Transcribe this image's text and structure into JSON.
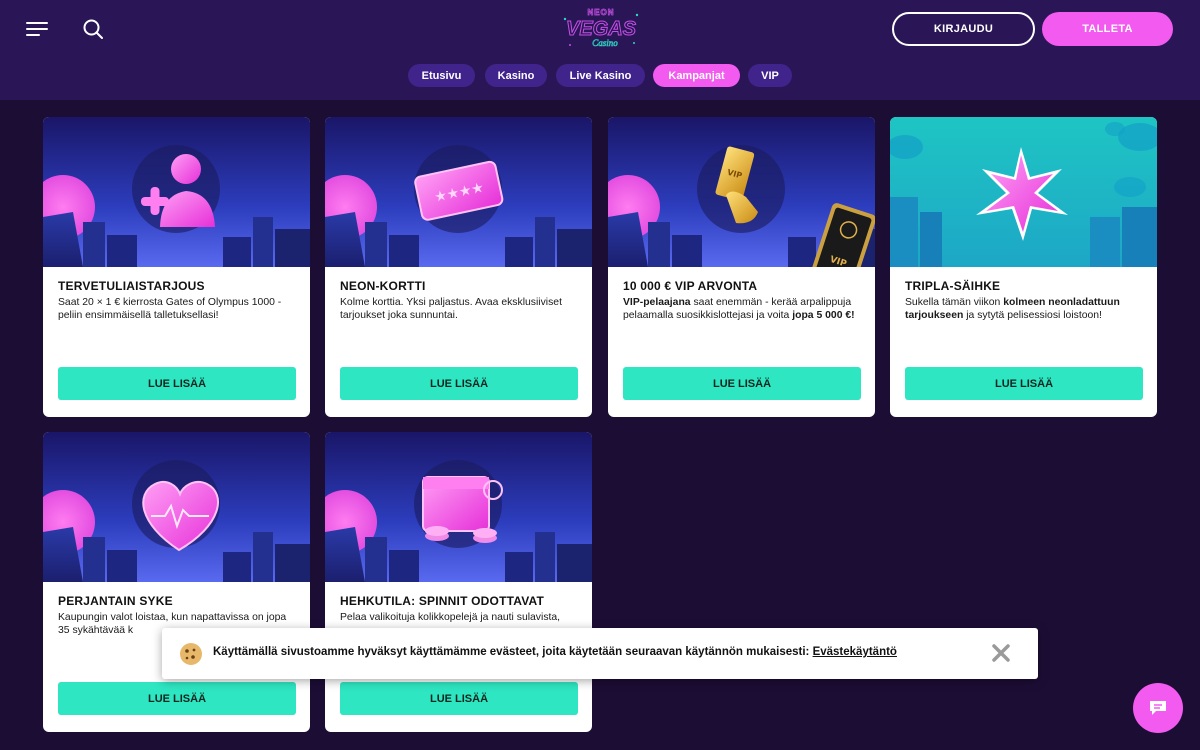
{
  "header": {
    "logo_text_top": "NEON",
    "logo_text_main": "VEGAS",
    "logo_text_sub": "Casino",
    "login_label": "KIRJAUDU",
    "deposit_label": "TALLETA"
  },
  "nav": [
    {
      "label": "Etusivu",
      "active": false
    },
    {
      "label": "Kasino",
      "active": false
    },
    {
      "label": "Live Kasino",
      "active": false
    },
    {
      "label": "Kampanjat",
      "active": true
    },
    {
      "label": "VIP",
      "active": false
    }
  ],
  "cards": [
    {
      "title": "TERVETULIAISTARJOUS",
      "desc_parts": [
        {
          "t": "Saat 20 × 1 € kierrosta Gates of Olympus 1000 -peliin ensimmäisellä talletuksellasi!",
          "b": false
        }
      ],
      "button": "LUE LISÄÄ",
      "icon": "add-user-icon"
    },
    {
      "title": "NEON-KORTTI",
      "desc_parts": [
        {
          "t": "Kolme korttia. Yksi paljastus. Avaa eksklusiiviset tarjoukset joka sunnuntai.",
          "b": false
        }
      ],
      "button": "LUE LISÄÄ",
      "icon": "ticket-icon"
    },
    {
      "title": "10 000 € VIP ARVONTA",
      "desc_parts": [
        {
          "t": "VIP-pelaajana",
          "b": true
        },
        {
          "t": " saat enemmän - kerää arpalippuja pelaamalla suosikkislottejasi ja voita ",
          "b": false
        },
        {
          "t": "jopa 5 000 €!",
          "b": true
        }
      ],
      "button": "LUE LISÄÄ",
      "icon": "vip-ticket-icon"
    },
    {
      "title": "TRIPLA-SÄIHKE",
      "desc_parts": [
        {
          "t": "Sukella tämän viikon ",
          "b": false
        },
        {
          "t": "kolmeen neonladattuun tarjoukseen",
          "b": true
        },
        {
          "t": " ja sytytä pelisessiosi loistoon!",
          "b": false
        }
      ],
      "button": "LUE LISÄÄ",
      "icon": "sparkle-icon"
    },
    {
      "title": "PERJANTAIN SYKE",
      "desc_parts": [
        {
          "t": "Kaupungin valot loistaa, kun napattavissa on jopa 35 sykähtävää k",
          "b": false
        }
      ],
      "button": "LUE LISÄÄ",
      "icon": "heart-icon"
    },
    {
      "title": "HEHKUTILA: SPINNIT ODOTTAVAT",
      "desc_parts": [
        {
          "t": "Pelaa valikoituja kolikkopelejä ja nauti sulavista,",
          "b": false
        }
      ],
      "button": "LUE LISÄÄ",
      "icon": "calendar-coins-icon"
    }
  ],
  "cookie": {
    "text": "Käyttämällä sivustoamme hyväksyt käyttämämme evästeet, joita käytetään seuraavan käytännön mukaisesti: ",
    "link": "Evästekäytäntö"
  },
  "colors": {
    "header_bg": "#2a1656",
    "page_bg": "#1c0d35",
    "accent_pink": "#f25af0",
    "button_teal": "#2ee6c2",
    "pill_bg": "#41248b"
  }
}
